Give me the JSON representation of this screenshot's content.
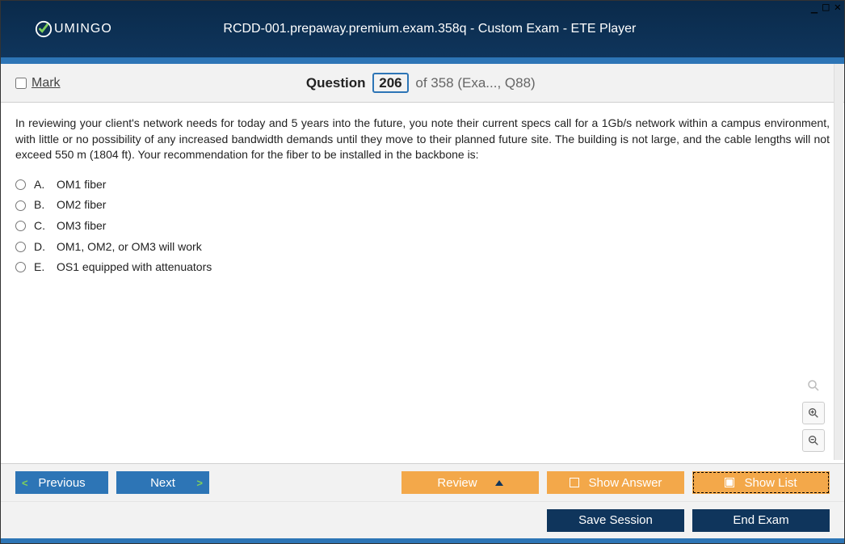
{
  "header": {
    "brand": "UMINGO",
    "app_title": "RCDD-001.prepaway.premium.exam.358q - Custom Exam - ETE Player"
  },
  "question_bar": {
    "mark_label": "Mark",
    "q_label": "Question",
    "current": "206",
    "of_total": "of 358 (Exa..., Q88)"
  },
  "question": {
    "text": "In reviewing your client's network needs for today and 5 years into the future, you note their current specs call for a 1Gb/s network within a campus environment, with little or no possibility of any increased bandwidth demands until they move to their planned future site. The building is not large, and the cable lengths will not exceed 550 m (1804 ft). Your recommendation for the fiber to be installed in the backbone is:",
    "answers": [
      {
        "letter": "A.",
        "text": "OM1 fiber"
      },
      {
        "letter": "B.",
        "text": "OM2 fiber"
      },
      {
        "letter": "C.",
        "text": "OM3 fiber"
      },
      {
        "letter": "D.",
        "text": "OM1, OM2, or OM3 will work"
      },
      {
        "letter": "E.",
        "text": "OS1 equipped with attenuators"
      }
    ]
  },
  "buttons": {
    "previous": "Previous",
    "next": "Next",
    "review": "Review",
    "show_answer": "Show Answer",
    "show_list": "Show List",
    "save_session": "Save Session",
    "end_exam": "End Exam"
  }
}
